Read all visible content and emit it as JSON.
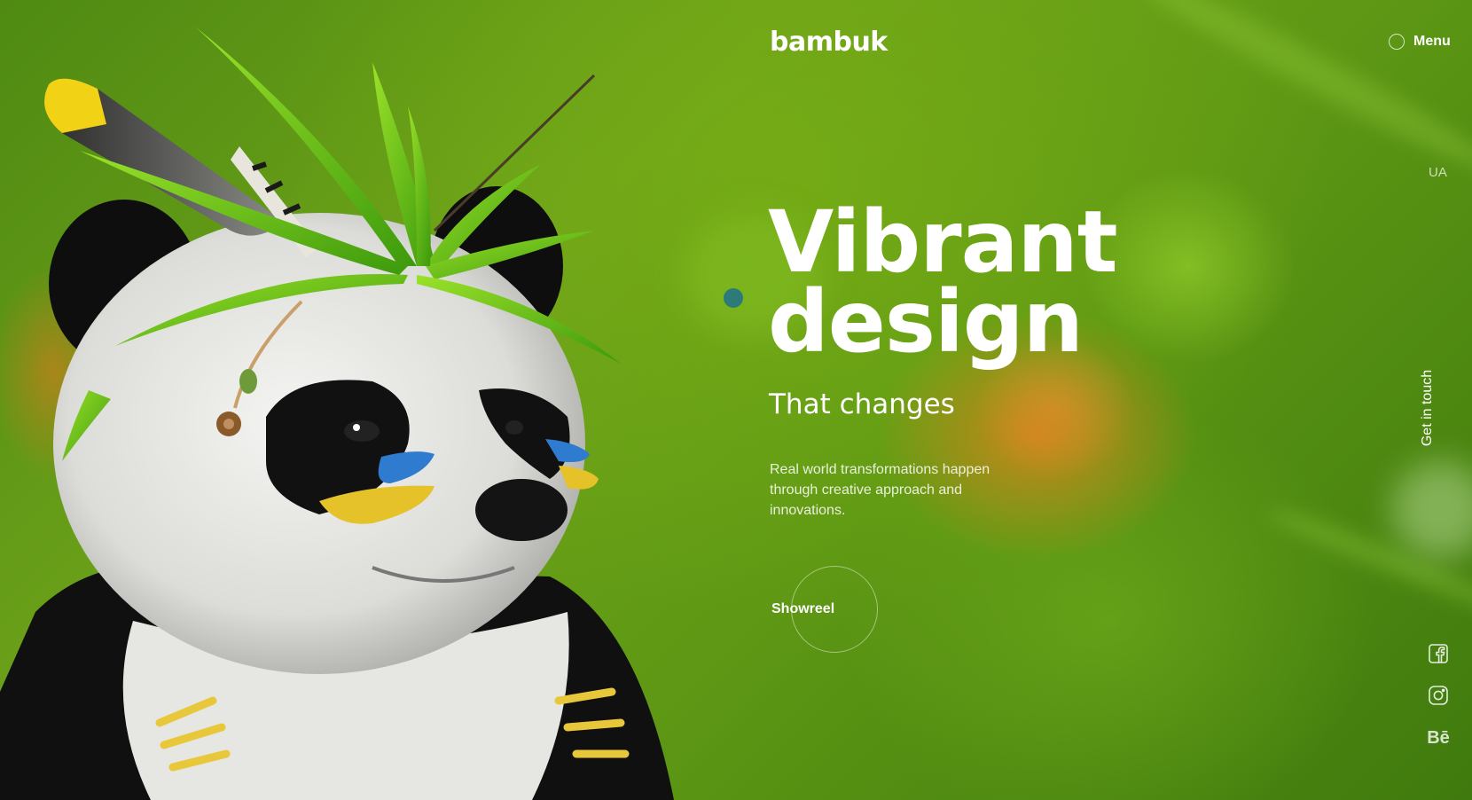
{
  "header": {
    "logo": "bambuk",
    "menu_label": "Menu",
    "lang": "UA"
  },
  "hero": {
    "title_line1": "Vibrant",
    "title_line2": "design",
    "subtitle": "That changes",
    "description": "Real world transformations happen through creative approach and innovations.",
    "showreel_label": "Showreel"
  },
  "side": {
    "contact_label": "Get in touch"
  },
  "social": {
    "behance_label": "Bē"
  },
  "colors": {
    "text": "#ffffff",
    "accent_dot": "#2e7a78",
    "background_green": "#5e9814",
    "bokeh_orange": "#ec801e"
  },
  "icons": [
    "facebook-icon",
    "instagram-icon",
    "behance-icon",
    "menu-circle-icon"
  ]
}
